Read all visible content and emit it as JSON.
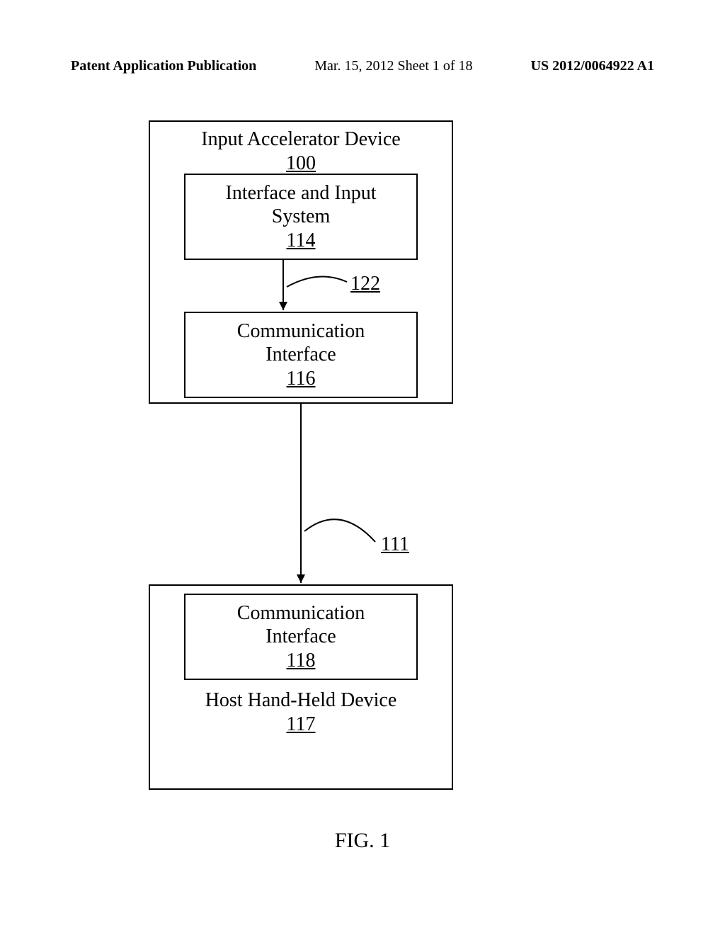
{
  "header": {
    "left": "Patent Application Publication",
    "mid": "Mar. 15, 2012  Sheet 1 of 18",
    "right": "US 2012/0064922 A1"
  },
  "boxes": {
    "a_title": "Input Accelerator Device",
    "a_ref": "100",
    "b_title1": "Interface and Input",
    "b_title2": "System",
    "b_ref": "114",
    "c_title1": "Communication",
    "c_title2": "Interface",
    "c_ref": "116",
    "d_title": "Host Hand-Held Device",
    "d_ref": "117",
    "e_title1": "Communication",
    "e_title2": "Interface",
    "e_ref": "118"
  },
  "refs": {
    "arrow_bc": "122",
    "arrow_ce": "111"
  },
  "figure": "FIG. 1"
}
